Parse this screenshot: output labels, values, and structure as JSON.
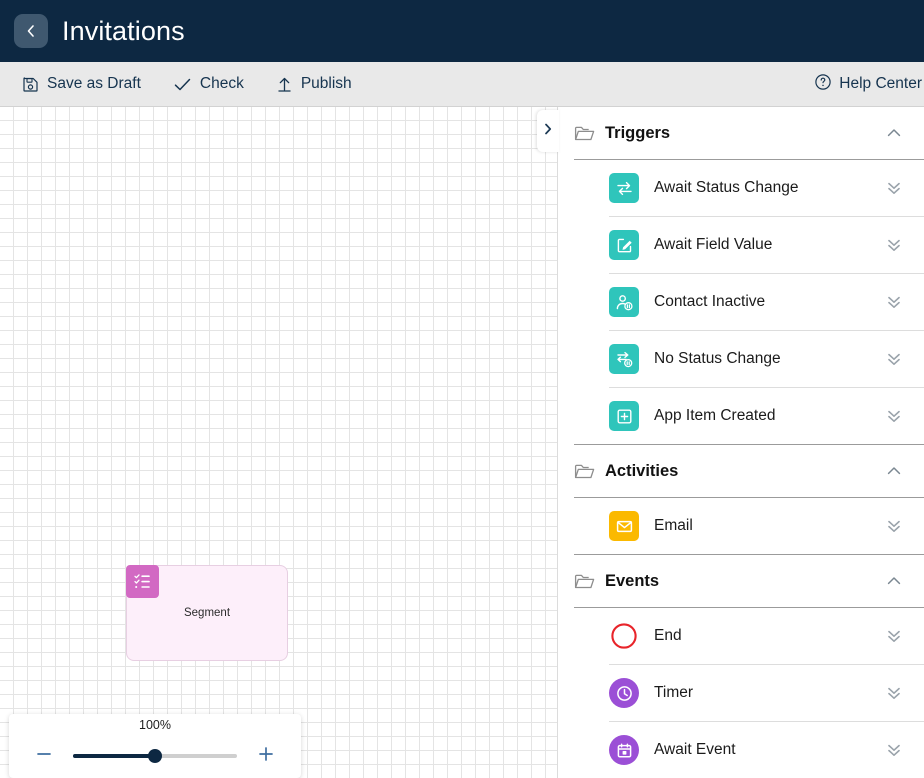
{
  "header": {
    "title": "Invitations",
    "back_icon": "chevron-left-icon",
    "background": "#0d2842"
  },
  "toolbar": {
    "buttons": [
      {
        "label": "Save as Draft",
        "icon": "floppy-save-icon"
      },
      {
        "label": "Check",
        "icon": "checkmark-icon"
      },
      {
        "label": "Publish",
        "icon": "upload-arrow-icon"
      }
    ],
    "help": {
      "label": "Help Center",
      "icon": "question-circle-icon"
    }
  },
  "canvas": {
    "collapse_tab_icon": "chevron-right-icon",
    "nodes": [
      {
        "label": "Segment",
        "icon": "checklist-icon",
        "icon_color": "#d269c3",
        "fill": "#fdeffa"
      }
    ],
    "zoom": {
      "percent": "100%",
      "value": 50,
      "minus_icon": "minus-icon",
      "plus_icon": "plus-icon"
    }
  },
  "panel": {
    "sections": [
      {
        "title": "Triggers",
        "folder_icon": "folder-icon",
        "collapse_icon": "chevron-up-icon",
        "items": [
          {
            "label": "Await Status Change",
            "icon": "swap-arrows-icon",
            "color": "#2fc5bb",
            "shape": "rounded",
            "expand_icon": "double-chevron-down-icon"
          },
          {
            "label": "Await Field Value",
            "icon": "edit-square-icon",
            "color": "#2fc5bb",
            "shape": "rounded",
            "expand_icon": "double-chevron-down-icon"
          },
          {
            "label": "Contact Inactive",
            "icon": "contact-pause-icon",
            "color": "#2fc5bb",
            "shape": "rounded",
            "expand_icon": "double-chevron-down-icon"
          },
          {
            "label": "No Status Change",
            "icon": "no-status-change-icon",
            "color": "#2fc5bb",
            "shape": "rounded",
            "expand_icon": "double-chevron-down-icon"
          },
          {
            "label": "App Item Created",
            "icon": "plus-square-icon",
            "color": "#2fc5bb",
            "shape": "rounded",
            "expand_icon": "double-chevron-down-icon"
          }
        ]
      },
      {
        "title": "Activities",
        "folder_icon": "folder-icon",
        "collapse_icon": "chevron-up-icon",
        "items": [
          {
            "label": "Email",
            "icon": "envelope-icon",
            "color": "#fbb900",
            "shape": "rounded",
            "expand_icon": "double-chevron-down-icon"
          }
        ]
      },
      {
        "title": "Events",
        "folder_icon": "folder-icon",
        "collapse_icon": "chevron-up-icon",
        "items": [
          {
            "label": "End",
            "icon": "end-circle-icon",
            "color": "#e8242a",
            "shape": "hollow-circle",
            "expand_icon": "double-chevron-down-icon"
          },
          {
            "label": "Timer",
            "icon": "clock-icon",
            "color": "#9b4fd6",
            "shape": "circle",
            "expand_icon": "double-chevron-down-icon"
          },
          {
            "label": "Await Event",
            "icon": "calendar-icon",
            "color": "#9b4fd6",
            "shape": "circle",
            "expand_icon": "double-chevron-down-icon"
          }
        ]
      }
    ]
  }
}
